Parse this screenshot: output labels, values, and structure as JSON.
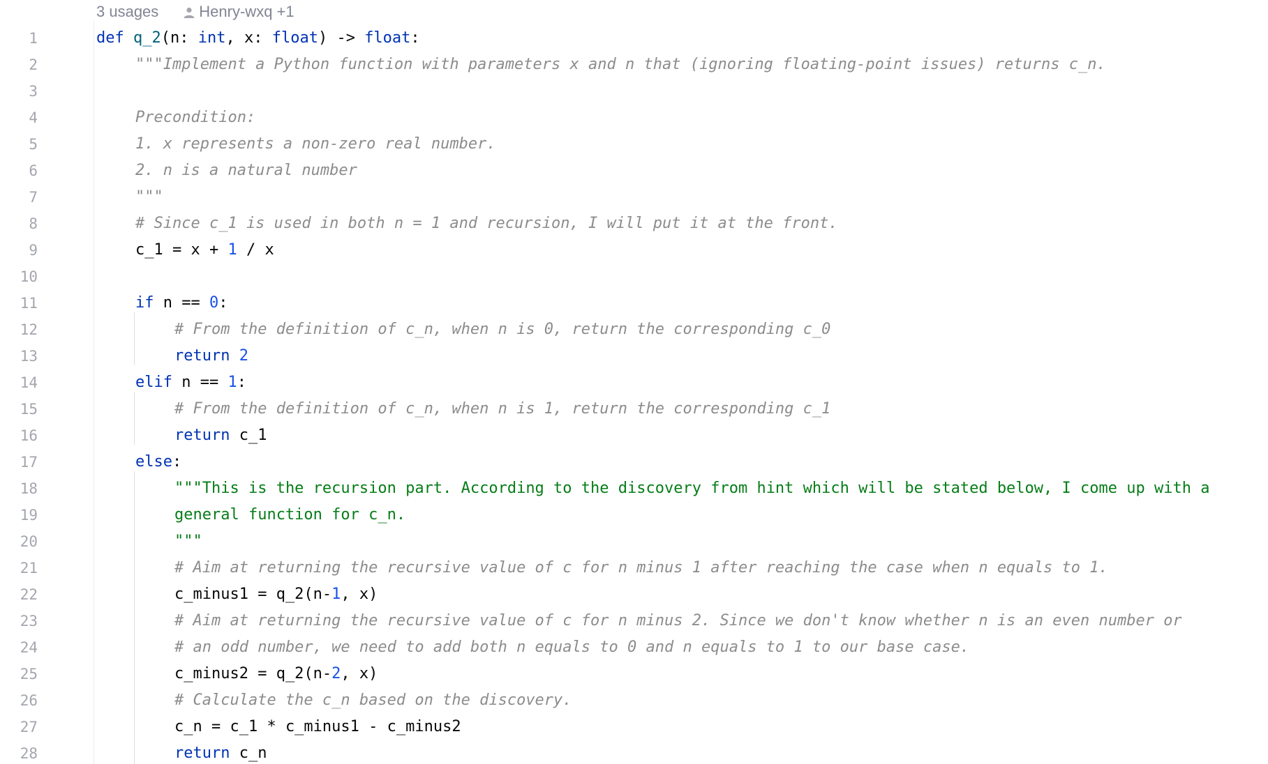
{
  "inlay_hints": {
    "usages": "3 usages",
    "author": "Henry-wxq +1",
    "author_icon": "person-icon"
  },
  "colors": {
    "keyword": "#0033b3",
    "function_name": "#00627a",
    "number": "#1750eb",
    "string": "#067d17",
    "comment": "#8c8c8c",
    "plain": "#080808",
    "line_number": "#a3a6ad"
  },
  "lines": [
    {
      "n": "1",
      "indent": 0,
      "tokens": [
        [
          "kw",
          "def"
        ],
        [
          "plain",
          " "
        ],
        [
          "fn",
          "q_2"
        ],
        [
          "plain",
          "(n: "
        ],
        [
          "kw",
          "int"
        ],
        [
          "plain",
          ", x: "
        ],
        [
          "kw",
          "float"
        ],
        [
          "plain",
          ") -> "
        ],
        [
          "kw",
          "float"
        ],
        [
          "plain",
          ":"
        ]
      ]
    },
    {
      "n": "2",
      "indent": 1,
      "tokens": [
        [
          "doc",
          "\"\"\"Implement a Python function with parameters x and n that (ignoring floating-point issues) returns c_n."
        ]
      ]
    },
    {
      "n": "3",
      "indent": 0,
      "tokens": []
    },
    {
      "n": "4",
      "indent": 1,
      "tokens": [
        [
          "doc",
          "Precondition:"
        ]
      ]
    },
    {
      "n": "5",
      "indent": 1,
      "tokens": [
        [
          "doc",
          "1. x represents a non-zero real number."
        ]
      ]
    },
    {
      "n": "6",
      "indent": 1,
      "tokens": [
        [
          "doc",
          "2. n is a natural number"
        ]
      ]
    },
    {
      "n": "7",
      "indent": 1,
      "tokens": [
        [
          "doc",
          "\"\"\""
        ]
      ]
    },
    {
      "n": "8",
      "indent": 1,
      "tokens": [
        [
          "cmt",
          "# Since c_1 is used in both n = 1 and recursion, I will put it at the front."
        ]
      ]
    },
    {
      "n": "9",
      "indent": 1,
      "tokens": [
        [
          "plain",
          "c_1 = x + "
        ],
        [
          "num",
          "1"
        ],
        [
          "plain",
          " / x"
        ]
      ]
    },
    {
      "n": "10",
      "indent": 0,
      "tokens": []
    },
    {
      "n": "11",
      "indent": 1,
      "tokens": [
        [
          "kw",
          "if"
        ],
        [
          "plain",
          " n == "
        ],
        [
          "num",
          "0"
        ],
        [
          "plain",
          ":"
        ]
      ]
    },
    {
      "n": "12",
      "indent": 2,
      "tokens": [
        [
          "cmt",
          "# From the definition of c_n, when n is 0, return the corresponding c_0"
        ]
      ]
    },
    {
      "n": "13",
      "indent": 2,
      "tokens": [
        [
          "kw",
          "return"
        ],
        [
          "plain",
          " "
        ],
        [
          "num",
          "2"
        ]
      ]
    },
    {
      "n": "14",
      "indent": 1,
      "tokens": [
        [
          "kw",
          "elif"
        ],
        [
          "plain",
          " n == "
        ],
        [
          "num",
          "1"
        ],
        [
          "plain",
          ":"
        ]
      ]
    },
    {
      "n": "15",
      "indent": 2,
      "tokens": [
        [
          "cmt",
          "# From the definition of c_n, when n is 1, return the corresponding c_1"
        ]
      ]
    },
    {
      "n": "16",
      "indent": 2,
      "tokens": [
        [
          "kw",
          "return"
        ],
        [
          "plain",
          " c_1"
        ]
      ]
    },
    {
      "n": "17",
      "indent": 1,
      "tokens": [
        [
          "kw",
          "else"
        ],
        [
          "plain",
          ":"
        ]
      ]
    },
    {
      "n": "18",
      "indent": 2,
      "tokens": [
        [
          "str",
          "\"\"\"This is the recursion part. According to the discovery from hint which will be stated below, I come up with a"
        ]
      ]
    },
    {
      "n": "19",
      "indent": 2,
      "tokens": [
        [
          "str",
          "general function for c_n."
        ]
      ]
    },
    {
      "n": "20",
      "indent": 2,
      "tokens": [
        [
          "str",
          "\"\"\""
        ]
      ]
    },
    {
      "n": "21",
      "indent": 2,
      "tokens": [
        [
          "cmt",
          "# Aim at returning the recursive value of c for n minus 1 after reaching the case when n equals to 1."
        ]
      ]
    },
    {
      "n": "22",
      "indent": 2,
      "tokens": [
        [
          "plain",
          "c_minus1 = q_2(n-"
        ],
        [
          "num",
          "1"
        ],
        [
          "plain",
          ", x)"
        ]
      ]
    },
    {
      "n": "23",
      "indent": 2,
      "tokens": [
        [
          "cmt",
          "# Aim at returning the recursive value of c for n minus 2. Since we don't know whether n is an even number or"
        ]
      ]
    },
    {
      "n": "24",
      "indent": 2,
      "tokens": [
        [
          "cmt",
          "# an odd number, we need to add both n equals to 0 and n equals to 1 to our base case."
        ]
      ]
    },
    {
      "n": "25",
      "indent": 2,
      "tokens": [
        [
          "plain",
          "c_minus2 = q_2(n-"
        ],
        [
          "num",
          "2"
        ],
        [
          "plain",
          ", x)"
        ]
      ]
    },
    {
      "n": "26",
      "indent": 2,
      "tokens": [
        [
          "cmt",
          "# Calculate the c_n based on the discovery."
        ]
      ]
    },
    {
      "n": "27",
      "indent": 2,
      "tokens": [
        [
          "plain",
          "c_n = c_1 * c_minus1 - c_minus2"
        ]
      ]
    },
    {
      "n": "28",
      "indent": 2,
      "tokens": [
        [
          "kw",
          "return"
        ],
        [
          "plain",
          " c_n"
        ]
      ]
    }
  ]
}
